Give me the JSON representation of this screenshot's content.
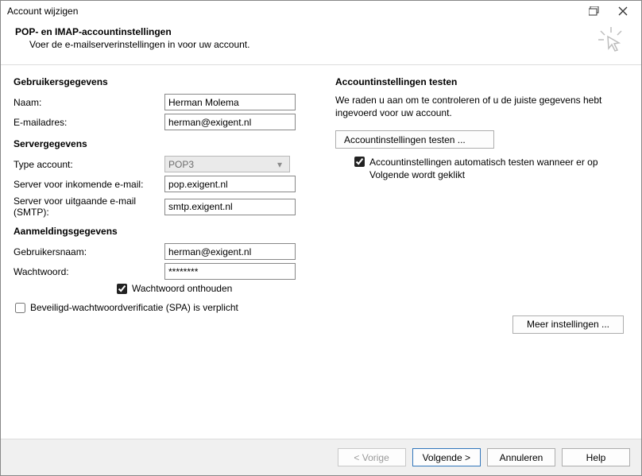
{
  "window": {
    "title": "Account wijzigen"
  },
  "header": {
    "title": "POP- en IMAP-accountinstellingen",
    "subtitle": "Voer de e-mailserverinstellingen in voor uw account."
  },
  "left": {
    "section_user": "Gebruikersgegevens",
    "name_label": "Naam:",
    "name_value": "Herman Molema",
    "email_label": "E-mailadres:",
    "email_value": "herman@exigent.nl",
    "section_server": "Servergegevens",
    "acct_type_label": "Type account:",
    "acct_type_value": "POP3",
    "incoming_label": "Server voor inkomende e-mail:",
    "incoming_value": "pop.exigent.nl",
    "outgoing_label": "Server voor uitgaande e-mail (SMTP):",
    "outgoing_value": "smtp.exigent.nl",
    "section_login": "Aanmeldingsgegevens",
    "user_label": "Gebruikersnaam:",
    "user_value": "herman@exigent.nl",
    "pass_label": "Wachtwoord:",
    "pass_value": "********",
    "remember_pw": "Wachtwoord onthouden",
    "spa": "Beveiligd-wachtwoordverificatie (SPA) is verplicht"
  },
  "right": {
    "section_test": "Accountinstellingen testen",
    "desc": "We raden u aan om te controleren of u de juiste gegevens hebt ingevoerd voor uw account.",
    "test_btn": "Accountinstellingen testen ...",
    "auto_test": "Accountinstellingen automatisch testen wanneer er op Volgende wordt geklikt",
    "more_btn": "Meer instellingen ..."
  },
  "footer": {
    "back": "< Vorige",
    "next": "Volgende >",
    "cancel": "Annuleren",
    "help": "Help"
  }
}
